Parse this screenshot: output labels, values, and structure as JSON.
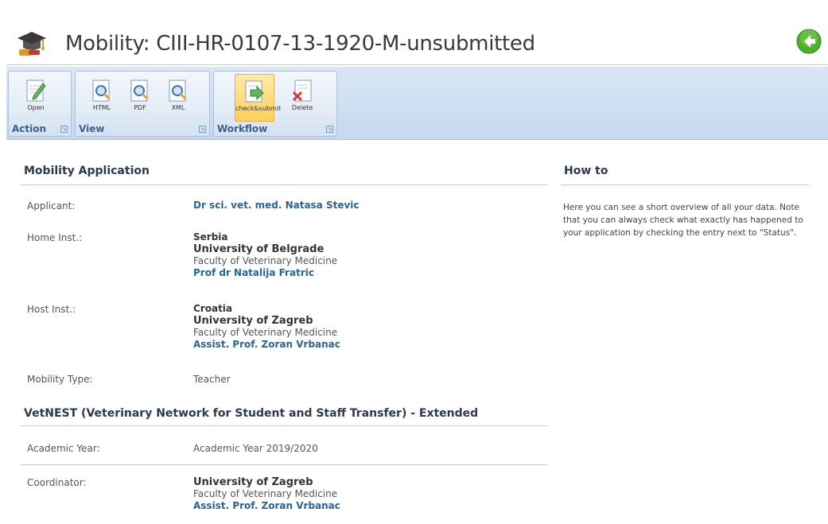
{
  "window": {
    "title": "Mobility: CIII-HR-0107-13-1920-M-unsubmitted"
  },
  "ribbon": {
    "groups": [
      {
        "label": "Action",
        "buttons": [
          {
            "label": "Open",
            "icon": "open-edit-icon"
          }
        ]
      },
      {
        "label": "View",
        "buttons": [
          {
            "label": "HTML",
            "icon": "html-view-icon"
          },
          {
            "label": "PDF",
            "icon": "pdf-view-icon"
          },
          {
            "label": "XML",
            "icon": "xml-view-icon"
          }
        ]
      },
      {
        "label": "Workflow",
        "buttons": [
          {
            "label": "check&submit",
            "icon": "check-submit-icon",
            "active": true
          },
          {
            "label": "Delete",
            "icon": "delete-icon"
          }
        ]
      }
    ]
  },
  "mobility": {
    "title": "Mobility Application",
    "applicant_label": "Applicant:",
    "applicant": "Dr sci. vet. med. Natasa Stevic",
    "home_label": "Home Inst.:",
    "home": {
      "country": "Serbia",
      "university": "University of Belgrade",
      "faculty": "Faculty of Veterinary Medicine",
      "contact": "Prof dr Natalija Fratric"
    },
    "host_label": "Host Inst.:",
    "host": {
      "country": "Croatia",
      "university": "University of Zagreb",
      "faculty": "Faculty of Veterinary Medicine",
      "contact": "Assist. Prof. Zoran Vrbanac"
    },
    "type_label": "Mobility Type:",
    "type": "Teacher"
  },
  "network": {
    "title": "VetNEST (Veterinary Network for Student and Staff Transfer) - Extended",
    "year_label": "Academic Year:",
    "year": "Academic Year 2019/2020",
    "coordinator_label": "Coordinator:",
    "coordinator": {
      "university": "University of Zagreb",
      "faculty": "Faculty of Veterinary Medicine",
      "contact": "Assist. Prof. Zoran Vrbanac"
    }
  },
  "howto": {
    "title": "How to",
    "text": "Here you can see a short overview of all your data. Note that you can always check what exactly has happened to your application by checking the entry next to \"Status\"."
  },
  "colors": {
    "link": "#2a6496",
    "ribbon": "#c3d8ef",
    "active_button": "#ffd15c",
    "back_button": "#4caf2a"
  }
}
